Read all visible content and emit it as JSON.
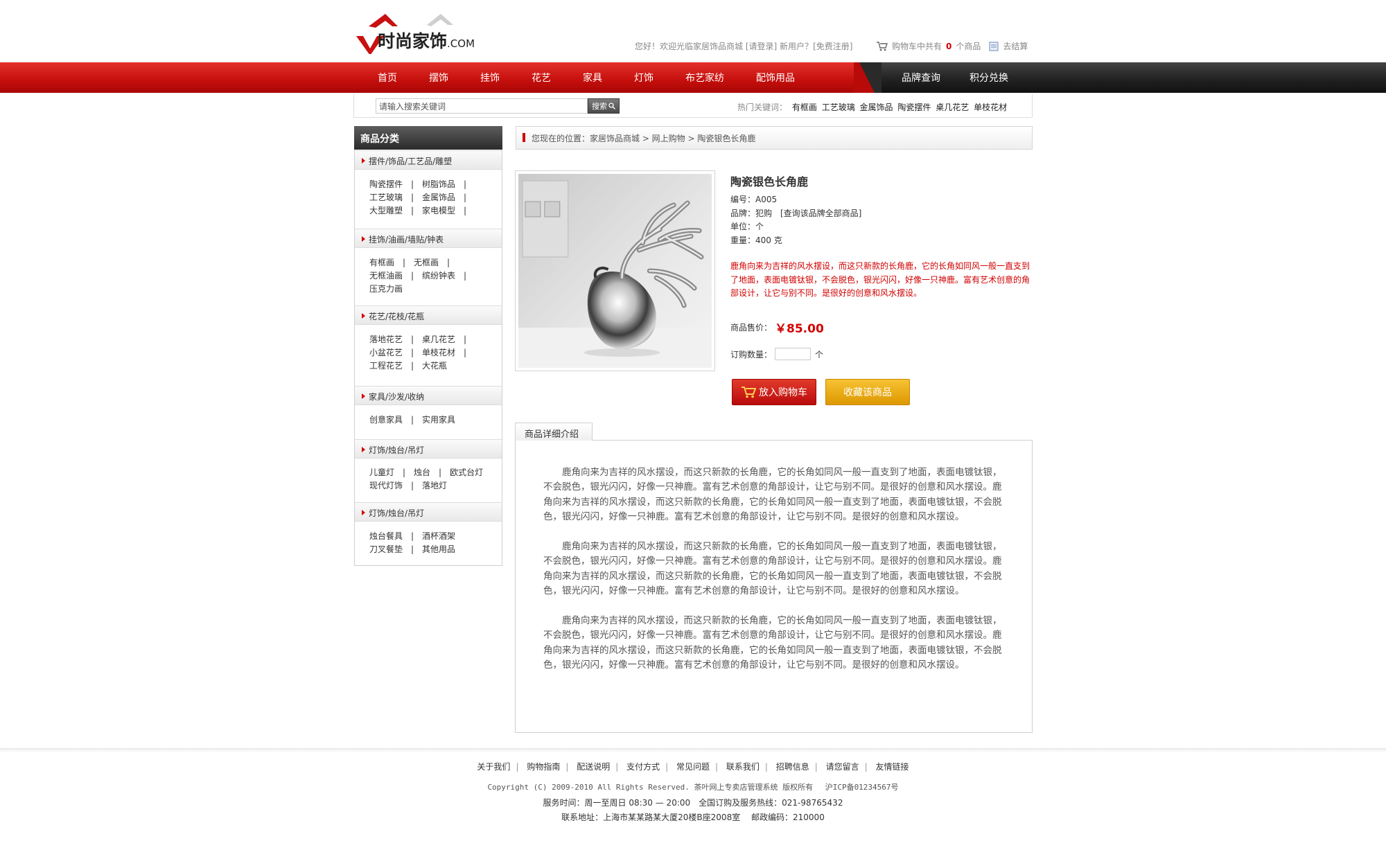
{
  "header": {
    "logo_text": "时尚家饰",
    "logo_suffix": ".COM",
    "welcome_prefix": "您好！欢迎光临家居饰品商城",
    "login_label": "[请登录]",
    "new_user_label": "新用户？",
    "register_label": "[免费注册]",
    "cart_prefix": "购物车中共有",
    "cart_count": "0",
    "cart_suffix": "个商品",
    "checkout_label": "去结算"
  },
  "nav": {
    "items": [
      {
        "label": "首页"
      },
      {
        "label": "摆饰"
      },
      {
        "label": "挂饰"
      },
      {
        "label": "花艺"
      },
      {
        "label": "家具"
      },
      {
        "label": "灯饰"
      },
      {
        "label": "布艺家纺"
      },
      {
        "label": "配饰用品"
      }
    ],
    "right_items": [
      {
        "label": "品牌查询"
      },
      {
        "label": "积分兑换"
      }
    ]
  },
  "search": {
    "placeholder": "请输入搜索关键词",
    "button_label": "搜索",
    "hot_label": "热门关键词：",
    "hot_keywords": [
      "有框画",
      "工艺玻璃",
      "金属饰品",
      "陶瓷摆件",
      "桌几花艺",
      "单枝花材"
    ]
  },
  "sidebar": {
    "title": "商品分类",
    "categories": [
      {
        "title": "摆件/饰品/工艺品/雕塑",
        "rows": [
          "陶瓷摆件　|　树脂饰品　|",
          "工艺玻璃　|　金属饰品　|",
          "大型雕塑　|　家电模型　|"
        ]
      },
      {
        "title": "挂饰/油画/墙贴/钟表",
        "rows": [
          "有框画　|　无框画　|",
          "无框油画　|　缤纷钟表　|",
          "压克力画"
        ]
      },
      {
        "title": "花艺/花枝/花瓶",
        "rows": [
          "落地花艺　|　桌几花艺　|",
          "小盆花艺　|　单枝花材　|",
          "工程花艺　|　大花瓶"
        ]
      },
      {
        "title": "家具/沙发/收纳",
        "rows": [
          "创意家具　|　实用家具"
        ]
      },
      {
        "title": "灯饰/烛台/吊灯",
        "rows": [
          "儿童灯　|　烛台　|　欧式台灯",
          "现代灯饰　|　落地灯"
        ]
      },
      {
        "title": "灯饰/烛台/吊灯",
        "rows": [
          "烛台餐具　|　酒杯酒架",
          "刀叉餐垫　|　其他用品"
        ]
      }
    ]
  },
  "breadcrumb": {
    "text": "您现在的位置：家居饰品商城 > 网上购物 > 陶瓷银色长角鹿"
  },
  "product": {
    "name": "陶瓷银色长角鹿",
    "code": "编号：A005",
    "brand": "品牌：犯购　[查询该品牌全部商品]",
    "unit": "单位：个",
    "weight": "重量：400 克",
    "description": "鹿角向来为吉祥的风水摆设，而这只新款的长角鹿，它的长角如同风一般一直支到了地面，表面电镀钛银，不会脱色，银光闪闪，好像一只神鹿。富有艺术创意的角部设计，让它与别不同。是很好的创意和风水摆设。",
    "price_label": "商品售价：",
    "price": "￥85.00",
    "qty_label": "订购数量：",
    "qty_unit": "个",
    "add_to_cart": "放入购物车",
    "favorite": "收藏该商品"
  },
  "detail": {
    "tab_label": "商品详细介绍",
    "paragraphs": [
      "鹿角向来为吉祥的风水摆设，而这只新款的长角鹿，它的长角如同风一般一直支到了地面，表面电镀钛银，不会脱色，银光闪闪，好像一只神鹿。富有艺术创意的角部设计，让它与别不同。是很好的创意和风水摆设。鹿角向来为吉祥的风水摆设，而这只新款的长角鹿，它的长角如同风一般一直支到了地面，表面电镀钛银，不会脱色，银光闪闪，好像一只神鹿。富有艺术创意的角部设计，让它与别不同。是很好的创意和风水摆设。",
      "鹿角向来为吉祥的风水摆设，而这只新款的长角鹿，它的长角如同风一般一直支到了地面，表面电镀钛银，不会脱色，银光闪闪，好像一只神鹿。富有艺术创意的角部设计，让它与别不同。是很好的创意和风水摆设。鹿角向来为吉祥的风水摆设，而这只新款的长角鹿，它的长角如同风一般一直支到了地面，表面电镀钛银，不会脱色，银光闪闪，好像一只神鹿。富有艺术创意的角部设计，让它与别不同。是很好的创意和风水摆设。",
      "鹿角向来为吉祥的风水摆设，而这只新款的长角鹿，它的长角如同风一般一直支到了地面，表面电镀钛银，不会脱色，银光闪闪，好像一只神鹿。富有艺术创意的角部设计，让它与别不同。是很好的创意和风水摆设。鹿角向来为吉祥的风水摆设，而这只新款的长角鹿，它的长角如同风一般一直支到了地面，表面电镀钛银，不会脱色，银光闪闪，好像一只神鹿。富有艺术创意的角部设计，让它与别不同。是很好的创意和风水摆设。"
    ]
  },
  "footer": {
    "links": [
      "关于我们",
      "购物指南",
      "配送说明",
      "支付方式",
      "常见问题",
      "联系我们",
      "招聘信息",
      "请您留言",
      "友情链接"
    ],
    "copyright": "Copyright (C) 2009-2010 All Rights Reserved. 茶叶网上专卖店管理系统 版权所有　 沪ICP备01234567号",
    "hours": "服务时间：周一至周日 08:30 — 20:00　全国订购及服务热线：021-98765432",
    "address": "联系地址：上海市某某路某大厦20楼B座2008室　 邮政编码：210000"
  },
  "colors": {
    "brand_red": "#d10000",
    "nav_dark": "#222222",
    "favorite_gold": "#e8a90f"
  },
  "icons": [
    "logo-house-icon",
    "cart-icon",
    "checkout-icon",
    "search-icon",
    "arrow-right-icon",
    "cart-button-icon"
  ]
}
